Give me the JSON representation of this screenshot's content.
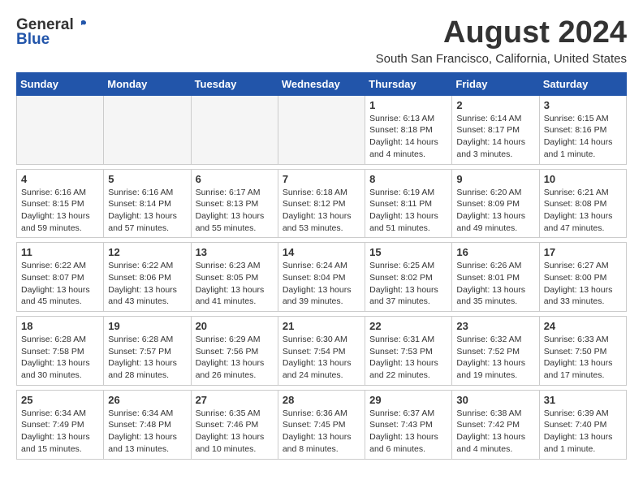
{
  "header": {
    "logo_general": "General",
    "logo_blue": "Blue",
    "main_title": "August 2024",
    "subtitle": "South San Francisco, California, United States"
  },
  "days_of_week": [
    "Sunday",
    "Monday",
    "Tuesday",
    "Wednesday",
    "Thursday",
    "Friday",
    "Saturday"
  ],
  "weeks": [
    {
      "days": [
        {
          "number": "",
          "info": ""
        },
        {
          "number": "",
          "info": ""
        },
        {
          "number": "",
          "info": ""
        },
        {
          "number": "",
          "info": ""
        },
        {
          "number": "1",
          "info": "Sunrise: 6:13 AM\nSunset: 8:18 PM\nDaylight: 14 hours\nand 4 minutes."
        },
        {
          "number": "2",
          "info": "Sunrise: 6:14 AM\nSunset: 8:17 PM\nDaylight: 14 hours\nand 3 minutes."
        },
        {
          "number": "3",
          "info": "Sunrise: 6:15 AM\nSunset: 8:16 PM\nDaylight: 14 hours\nand 1 minute."
        }
      ]
    },
    {
      "days": [
        {
          "number": "4",
          "info": "Sunrise: 6:16 AM\nSunset: 8:15 PM\nDaylight: 13 hours\nand 59 minutes."
        },
        {
          "number": "5",
          "info": "Sunrise: 6:16 AM\nSunset: 8:14 PM\nDaylight: 13 hours\nand 57 minutes."
        },
        {
          "number": "6",
          "info": "Sunrise: 6:17 AM\nSunset: 8:13 PM\nDaylight: 13 hours\nand 55 minutes."
        },
        {
          "number": "7",
          "info": "Sunrise: 6:18 AM\nSunset: 8:12 PM\nDaylight: 13 hours\nand 53 minutes."
        },
        {
          "number": "8",
          "info": "Sunrise: 6:19 AM\nSunset: 8:11 PM\nDaylight: 13 hours\nand 51 minutes."
        },
        {
          "number": "9",
          "info": "Sunrise: 6:20 AM\nSunset: 8:09 PM\nDaylight: 13 hours\nand 49 minutes."
        },
        {
          "number": "10",
          "info": "Sunrise: 6:21 AM\nSunset: 8:08 PM\nDaylight: 13 hours\nand 47 minutes."
        }
      ]
    },
    {
      "days": [
        {
          "number": "11",
          "info": "Sunrise: 6:22 AM\nSunset: 8:07 PM\nDaylight: 13 hours\nand 45 minutes."
        },
        {
          "number": "12",
          "info": "Sunrise: 6:22 AM\nSunset: 8:06 PM\nDaylight: 13 hours\nand 43 minutes."
        },
        {
          "number": "13",
          "info": "Sunrise: 6:23 AM\nSunset: 8:05 PM\nDaylight: 13 hours\nand 41 minutes."
        },
        {
          "number": "14",
          "info": "Sunrise: 6:24 AM\nSunset: 8:04 PM\nDaylight: 13 hours\nand 39 minutes."
        },
        {
          "number": "15",
          "info": "Sunrise: 6:25 AM\nSunset: 8:02 PM\nDaylight: 13 hours\nand 37 minutes."
        },
        {
          "number": "16",
          "info": "Sunrise: 6:26 AM\nSunset: 8:01 PM\nDaylight: 13 hours\nand 35 minutes."
        },
        {
          "number": "17",
          "info": "Sunrise: 6:27 AM\nSunset: 8:00 PM\nDaylight: 13 hours\nand 33 minutes."
        }
      ]
    },
    {
      "days": [
        {
          "number": "18",
          "info": "Sunrise: 6:28 AM\nSunset: 7:58 PM\nDaylight: 13 hours\nand 30 minutes."
        },
        {
          "number": "19",
          "info": "Sunrise: 6:28 AM\nSunset: 7:57 PM\nDaylight: 13 hours\nand 28 minutes."
        },
        {
          "number": "20",
          "info": "Sunrise: 6:29 AM\nSunset: 7:56 PM\nDaylight: 13 hours\nand 26 minutes."
        },
        {
          "number": "21",
          "info": "Sunrise: 6:30 AM\nSunset: 7:54 PM\nDaylight: 13 hours\nand 24 minutes."
        },
        {
          "number": "22",
          "info": "Sunrise: 6:31 AM\nSunset: 7:53 PM\nDaylight: 13 hours\nand 22 minutes."
        },
        {
          "number": "23",
          "info": "Sunrise: 6:32 AM\nSunset: 7:52 PM\nDaylight: 13 hours\nand 19 minutes."
        },
        {
          "number": "24",
          "info": "Sunrise: 6:33 AM\nSunset: 7:50 PM\nDaylight: 13 hours\nand 17 minutes."
        }
      ]
    },
    {
      "days": [
        {
          "number": "25",
          "info": "Sunrise: 6:34 AM\nSunset: 7:49 PM\nDaylight: 13 hours\nand 15 minutes."
        },
        {
          "number": "26",
          "info": "Sunrise: 6:34 AM\nSunset: 7:48 PM\nDaylight: 13 hours\nand 13 minutes."
        },
        {
          "number": "27",
          "info": "Sunrise: 6:35 AM\nSunset: 7:46 PM\nDaylight: 13 hours\nand 10 minutes."
        },
        {
          "number": "28",
          "info": "Sunrise: 6:36 AM\nSunset: 7:45 PM\nDaylight: 13 hours\nand 8 minutes."
        },
        {
          "number": "29",
          "info": "Sunrise: 6:37 AM\nSunset: 7:43 PM\nDaylight: 13 hours\nand 6 minutes."
        },
        {
          "number": "30",
          "info": "Sunrise: 6:38 AM\nSunset: 7:42 PM\nDaylight: 13 hours\nand 4 minutes."
        },
        {
          "number": "31",
          "info": "Sunrise: 6:39 AM\nSunset: 7:40 PM\nDaylight: 13 hours\nand 1 minute."
        }
      ]
    }
  ]
}
